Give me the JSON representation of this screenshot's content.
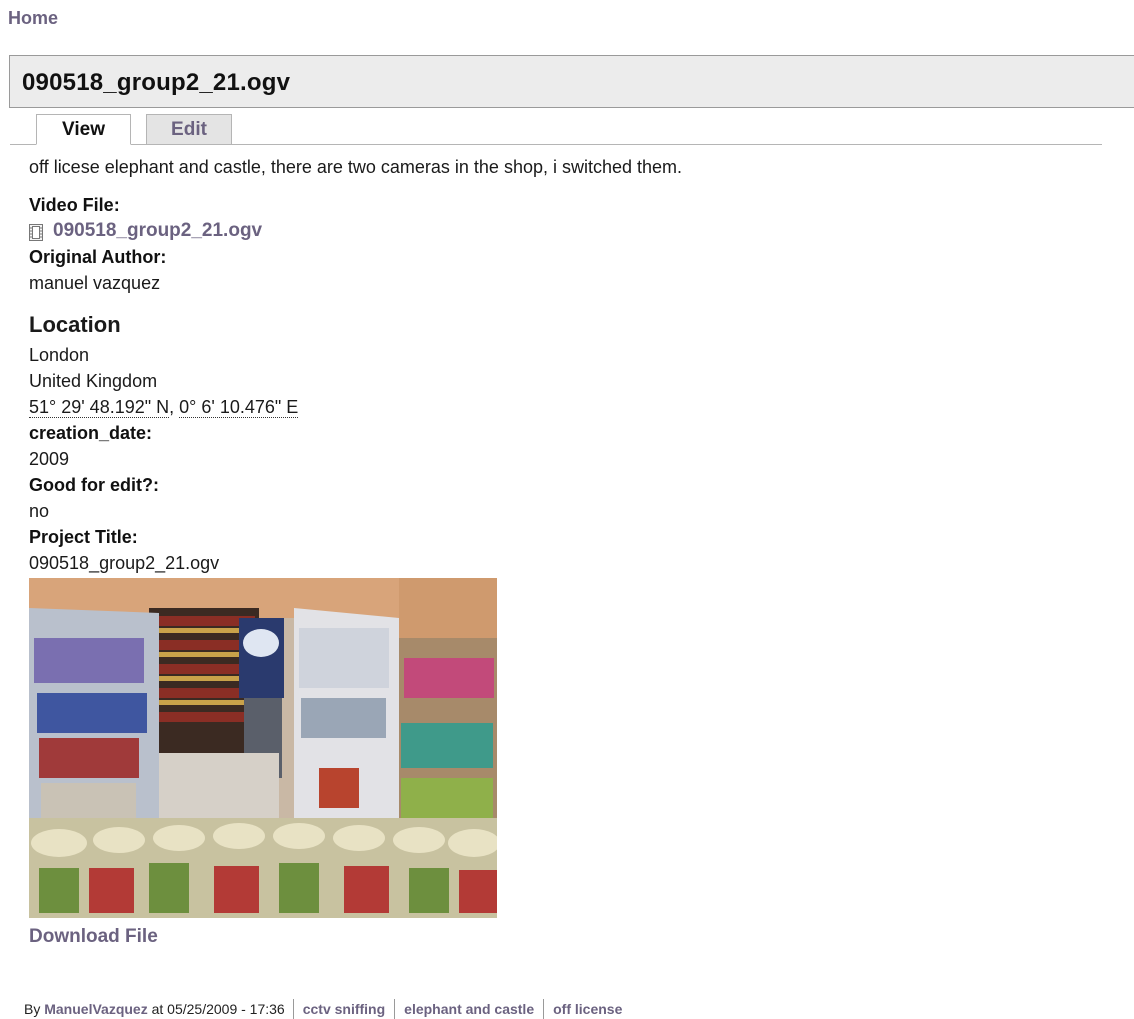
{
  "breadcrumb": {
    "home": "Home"
  },
  "page": {
    "title": "090518_group2_21.ogv"
  },
  "tabs": [
    {
      "label": "View"
    },
    {
      "label": "Edit"
    }
  ],
  "body_text": "off licese elephant and castle, there are two cameras in the shop, i switched them.",
  "fields": {
    "video_file": {
      "label": "Video File:",
      "value": "090518_group2_21.ogv",
      "icon": "video-file-icon"
    },
    "original_author": {
      "label": "Original Author:",
      "value": "manuel vazquez"
    },
    "location": {
      "heading": "Location",
      "city": "London",
      "country": "United Kingdom",
      "latitude": "51° 29' 48.192\" N",
      "separator": ",",
      "longitude": "0° 6' 10.476\" E"
    },
    "creation_date": {
      "label": "creation_date:",
      "value": "2009"
    },
    "good_for_edit": {
      "label": "Good for edit?:",
      "value": "no"
    },
    "project_title": {
      "label": "Project Title:",
      "value": "090518_group2_21.ogv"
    }
  },
  "download_label": "Download File",
  "footer": {
    "by_prefix": "By",
    "author": "ManuelVazquez",
    "at_text": "at 05/25/2009 - 17:36",
    "terms": [
      "cctv sniffing",
      "elephant and castle",
      "off license"
    ]
  },
  "colors": {
    "link": "#6b6280",
    "title_bar_bg": "#ececec",
    "tab_inactive_bg": "#e4e4e4"
  }
}
